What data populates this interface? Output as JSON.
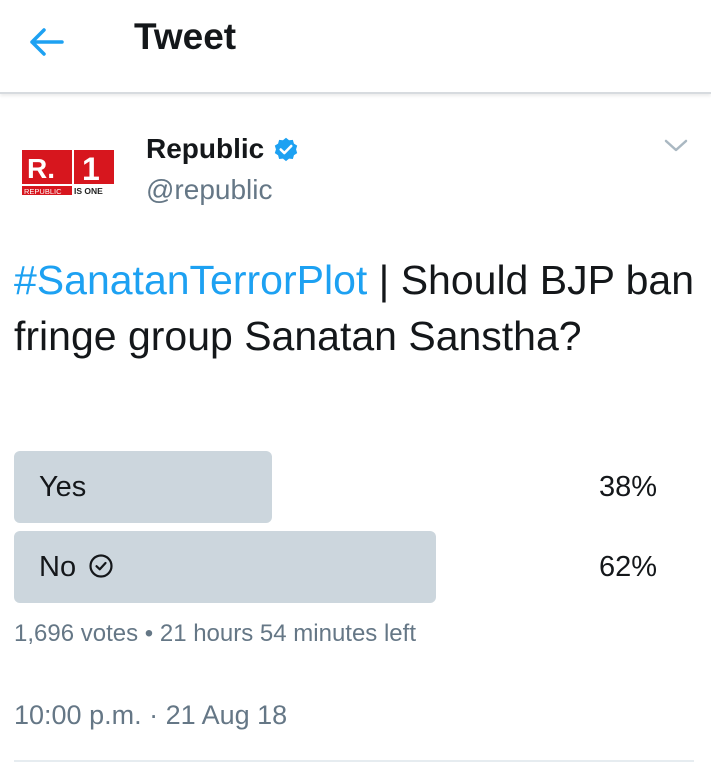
{
  "header": {
    "title": "Tweet",
    "back_icon": "arrow-left-icon"
  },
  "author": {
    "name": "Republic",
    "handle": "@republic",
    "verified_icon": "verified-badge-icon",
    "avatar": {
      "big_text": "R.",
      "number": "1",
      "tagline_left": "REPUBLIC",
      "tagline_right": "IS ONE"
    }
  },
  "tweet": {
    "hashtag": "#SanatanTerrorPlot",
    "text": " | Should BJP ban fringe group Sanatan Sanstha?"
  },
  "poll": {
    "options": [
      {
        "label": "Yes",
        "percent_text": "38%",
        "fraction": 0.38,
        "selected": false
      },
      {
        "label": "No",
        "percent_text": "62%",
        "fraction": 0.62,
        "selected": true
      }
    ],
    "votes": "1,696 votes",
    "separator": "•",
    "time_left": "21 hours 54 minutes left"
  },
  "timestamp": "10:00 p.m. · 21 Aug 18",
  "colors": {
    "accent": "#1da1f2",
    "bar": "#ccd6dd",
    "secondary_text": "#657786",
    "brand_red": "#d7161e"
  }
}
